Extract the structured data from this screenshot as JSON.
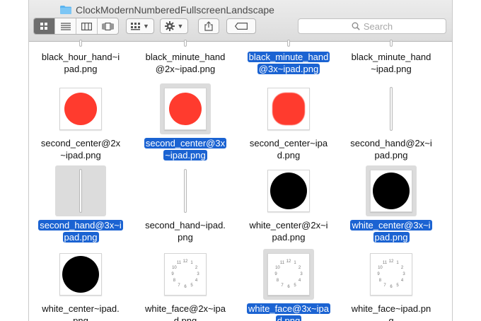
{
  "window": {
    "title": "ClockModernNumberedFullscreenLandscape"
  },
  "toolbar": {
    "view_icons": [
      "icon-view-icon",
      "list-view-icon",
      "column-view-icon",
      "coverflow-view-icon"
    ],
    "active_view": 0,
    "search_placeholder": "Search"
  },
  "colors": {
    "selection": "#1b63d2",
    "red_dot": "#ff3b2e"
  },
  "files": [
    {
      "name1": "black_hour_hand~i",
      "name2": "pad.png",
      "selected": false,
      "thumb": "hand-top"
    },
    {
      "name1": "black_minute_hand",
      "name2": "@2x~ipad.png",
      "selected": false,
      "thumb": "hand-top"
    },
    {
      "name1": "black_minute_hand",
      "name2": "@3x~ipad.png",
      "selected": true,
      "thumb": "hand-top"
    },
    {
      "name1": "black_minute_hand",
      "name2": "~ipad.png",
      "selected": false,
      "thumb": "hand-top"
    },
    {
      "name1": "second_center@2x",
      "name2": "~ipad.png",
      "selected": false,
      "thumb": "red"
    },
    {
      "name1": "second_center@3x",
      "name2": "~ipad.png",
      "selected": true,
      "thumb": "red"
    },
    {
      "name1": "second_center~ipa",
      "name2": "d.png",
      "selected": false,
      "thumb": "red-pixel"
    },
    {
      "name1": "second_hand@2x~i",
      "name2": "pad.png",
      "selected": false,
      "thumb": "hand"
    },
    {
      "name1": "second_hand@3x~i",
      "name2": "pad.png",
      "selected": true,
      "thumb": "hand"
    },
    {
      "name1": "second_hand~ipad.",
      "name2": "png",
      "selected": false,
      "thumb": "hand"
    },
    {
      "name1": "white_center@2x~i",
      "name2": "pad.png",
      "selected": false,
      "thumb": "black"
    },
    {
      "name1": "white_center@3x~i",
      "name2": "pad.png",
      "selected": true,
      "thumb": "black"
    },
    {
      "name1": "white_center~ipad.",
      "name2": "png",
      "selected": false,
      "thumb": "black"
    },
    {
      "name1": "white_face@2x~ipa",
      "name2": "d.png",
      "selected": false,
      "thumb": "face"
    },
    {
      "name1": "white_face@3x~ipa",
      "name2": "d.png",
      "selected": true,
      "thumb": "face"
    },
    {
      "name1": "white_face~ipad.pn",
      "name2": "g",
      "selected": false,
      "thumb": "face"
    }
  ],
  "clock_numbers": [
    "12",
    "1",
    "2",
    "3",
    "4",
    "5",
    "6",
    "7",
    "8",
    "9",
    "10",
    "11"
  ]
}
